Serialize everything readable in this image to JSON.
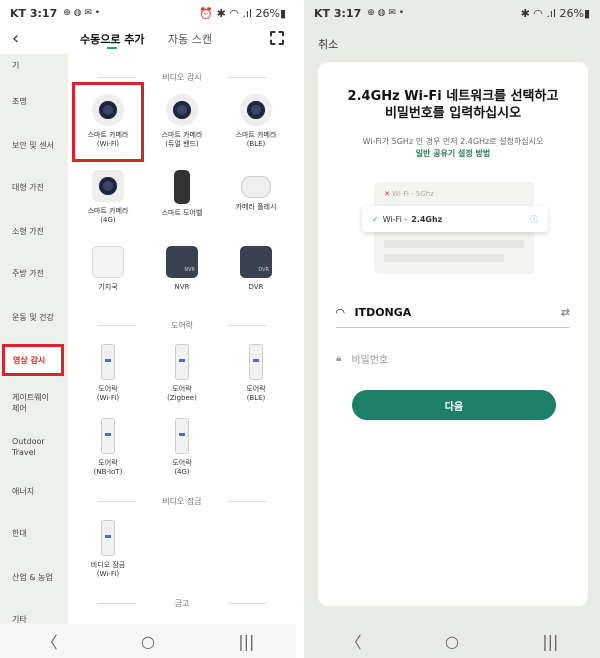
{
  "status_left": {
    "time": "KT 3:17",
    "icons": "⊕ ◍ ✉ •",
    "right": "⏰ ✱ ◠ .ıl 26%▮"
  },
  "status_right": {
    "time": "KT 3:17",
    "icons": "⊕ ◍ ✉ •",
    "right": "✱ ◠ .ıl 26%▮"
  },
  "header": {
    "back": "‹",
    "tab_manual": "수동으로 추가",
    "tab_auto": "자동 스캔"
  },
  "sidebar": {
    "items": [
      "기",
      "조명",
      "보안 및 센서",
      "대형 가전",
      "소형 가전",
      "주방 가전",
      "운동 및 건강",
      "영상 감시",
      "게이트웨이\n제어",
      "Outdoor\nTravel",
      "애너지",
      "한대",
      "산업 & 농업",
      "기타"
    ]
  },
  "sections": {
    "video": "비디오 감시",
    "doorlock": "도어락",
    "video_lock": "비디오 잠금",
    "more": "금고"
  },
  "devices": [
    {
      "label": "스마트 카메라\n(Wi-Fi)",
      "icon": "camera-icon"
    },
    {
      "label": "스마트 카메라\n(듀얼 밴드)",
      "icon": "camera-icon"
    },
    {
      "label": "스마트 카메라\n(BLE)",
      "icon": "camera-icon"
    },
    {
      "label": "스마트 카메라\n(4G)",
      "icon": "camera-4g-icon"
    },
    {
      "label": "스마트 도어벨",
      "icon": "doorbell-icon"
    },
    {
      "label": "카메라 플레시",
      "icon": "floodlight-icon"
    },
    {
      "label": "기지국",
      "icon": "base-station-icon"
    },
    {
      "label": "NVR",
      "icon": "nvr-icon"
    },
    {
      "label": "DVR",
      "icon": "dvr-icon"
    },
    {
      "label": "도어락\n(Wi-Fi)",
      "icon": "doorlock-icon"
    },
    {
      "label": "도어락\n(Zigbee)",
      "icon": "doorlock-icon"
    },
    {
      "label": "도어락\n(BLE)",
      "icon": "doorlock-icon"
    },
    {
      "label": "도어락\n(NB-IoT)",
      "icon": "doorlock-icon"
    },
    {
      "label": "도어락\n(4G)",
      "icon": "doorlock-icon"
    },
    {
      "label": "비디오 잠금\n(Wi-Fi)",
      "icon": "doorlock-icon"
    }
  ],
  "icon_text": {
    "nvr": "NVR",
    "dvr": "DVR"
  },
  "right": {
    "cancel": "취소",
    "title_line1": "2.4GHz Wi-Fi 네트워크를 선택하고",
    "title_line2": "비밀번호를 입력하십시오",
    "subtitle": "Wi-Fi가 5GHz 인 경우 먼저 2.4GHz로 설정하십시오",
    "link": "일반 공유기 설정 방법",
    "ill_5g": "Wi-Fi - 5Ghz",
    "ill_24_prefix": "Wi-Fi -",
    "ill_24": "2.4Ghz",
    "ssid": "ITDONGA",
    "password_placeholder": "비밀번호",
    "next": "다음"
  },
  "nav": {
    "back": "〈",
    "home": "○",
    "recent": "|||"
  }
}
